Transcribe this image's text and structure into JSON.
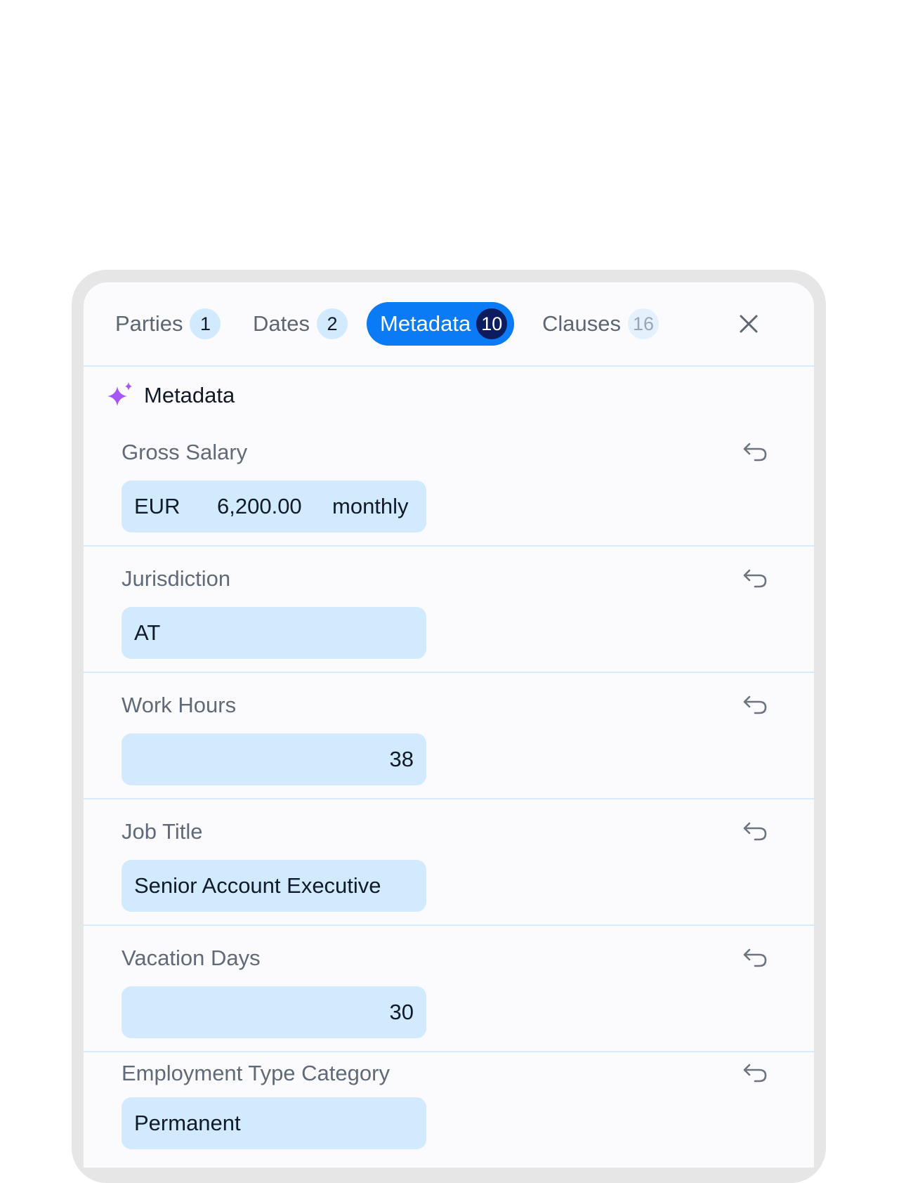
{
  "tabs": [
    {
      "label": "Parties",
      "count": "1"
    },
    {
      "label": "Dates",
      "count": "2"
    },
    {
      "label": "Metadata",
      "count": "10"
    },
    {
      "label": "Clauses",
      "count": "16"
    }
  ],
  "active_tab": "Metadata",
  "close_icon": "close-icon",
  "section": {
    "title": "Metadata",
    "icon": "sparkle-icon"
  },
  "fields": {
    "gross_salary": {
      "label": "Gross Salary",
      "currency": "EUR",
      "amount": "6,200.00",
      "period": "monthly"
    },
    "jurisdiction": {
      "label": "Jurisdiction",
      "value": "AT"
    },
    "work_hours": {
      "label": "Work Hours",
      "value": "38"
    },
    "job_title": {
      "label": "Job Title",
      "value": "Senior Account Executive"
    },
    "vacation_days": {
      "label": "Vacation Days",
      "value": "30"
    },
    "employment_type": {
      "label": "Employment Type Category",
      "value": "Permanent"
    }
  },
  "reset_icon": "undo-icon",
  "colors": {
    "accent": "#0a7bf5",
    "badge_dark": "#0d1c5e",
    "field_bg": "#d2eafd",
    "divider": "#d6ecfb",
    "sparkle": "#a855f7"
  }
}
